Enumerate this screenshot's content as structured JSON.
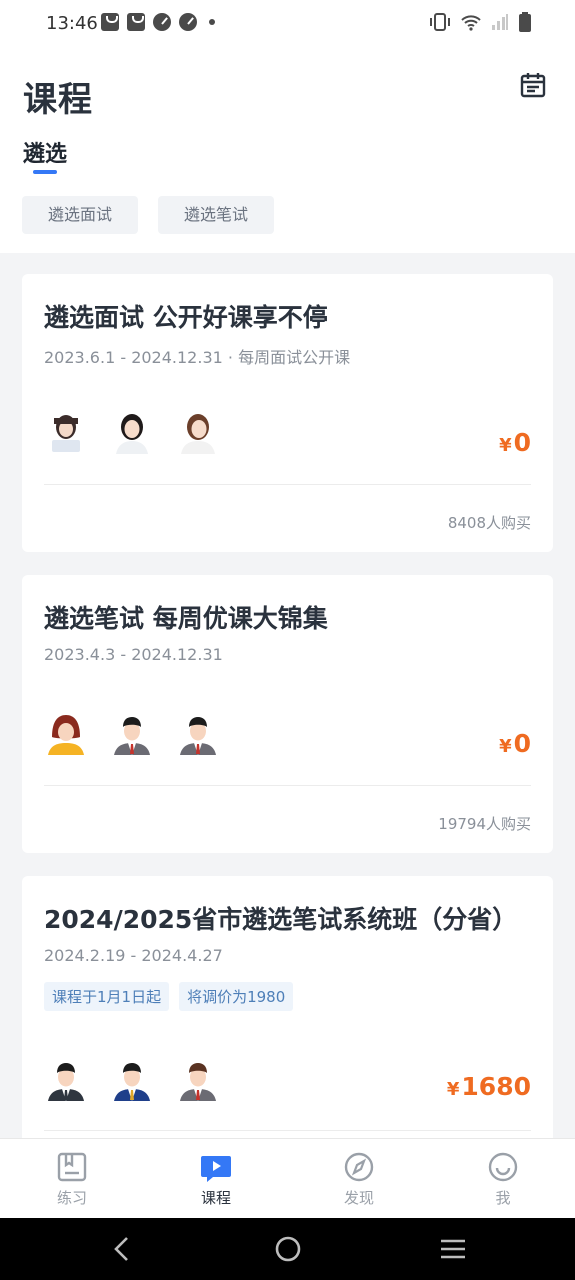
{
  "status_bar": {
    "time": "13:46"
  },
  "header": {
    "title": "课程",
    "active_tab": "遴选",
    "chips": [
      "遴选面试",
      "遴选笔试"
    ]
  },
  "courses": [
    {
      "title": "遴选面试 公开好课享不停",
      "subtitle": "2023.6.1 - 2024.12.31 · 每周面试公开课",
      "currency": "¥",
      "price": "0",
      "buyers": "8408人购买",
      "avatars": [
        "teacher-female-avatar",
        "teacher-female-avatar",
        "teacher-female-avatar"
      ]
    },
    {
      "title": "遴选笔试 每周优课大锦集",
      "subtitle": "2023.4.3 - 2024.12.31",
      "currency": "¥",
      "price": "0",
      "buyers": "19794人购买",
      "avatars": [
        "teacher-female-cartoon-avatar",
        "teacher-male-cartoon-avatar",
        "teacher-male-cartoon-avatar"
      ]
    },
    {
      "title": "2024/2025省市遴选笔试系统班（分省）",
      "subtitle": "2024.2.19 - 2024.4.27",
      "tags": [
        "课程于1月1日起",
        "将调价为1980"
      ],
      "currency": "¥",
      "price": "1680",
      "avatars": [
        "teacher-male-cartoon-avatar",
        "teacher-male-cartoon-avatar",
        "teacher-male-cartoon-avatar"
      ]
    }
  ],
  "tabbar": {
    "items": [
      {
        "label": "练习",
        "icon": "book-icon"
      },
      {
        "label": "课程",
        "icon": "play-icon"
      },
      {
        "label": "发现",
        "icon": "compass-icon"
      },
      {
        "label": "我",
        "icon": "smile-icon"
      }
    ]
  },
  "colors": {
    "accent": "#3478f6",
    "price": "#ef6b21"
  }
}
